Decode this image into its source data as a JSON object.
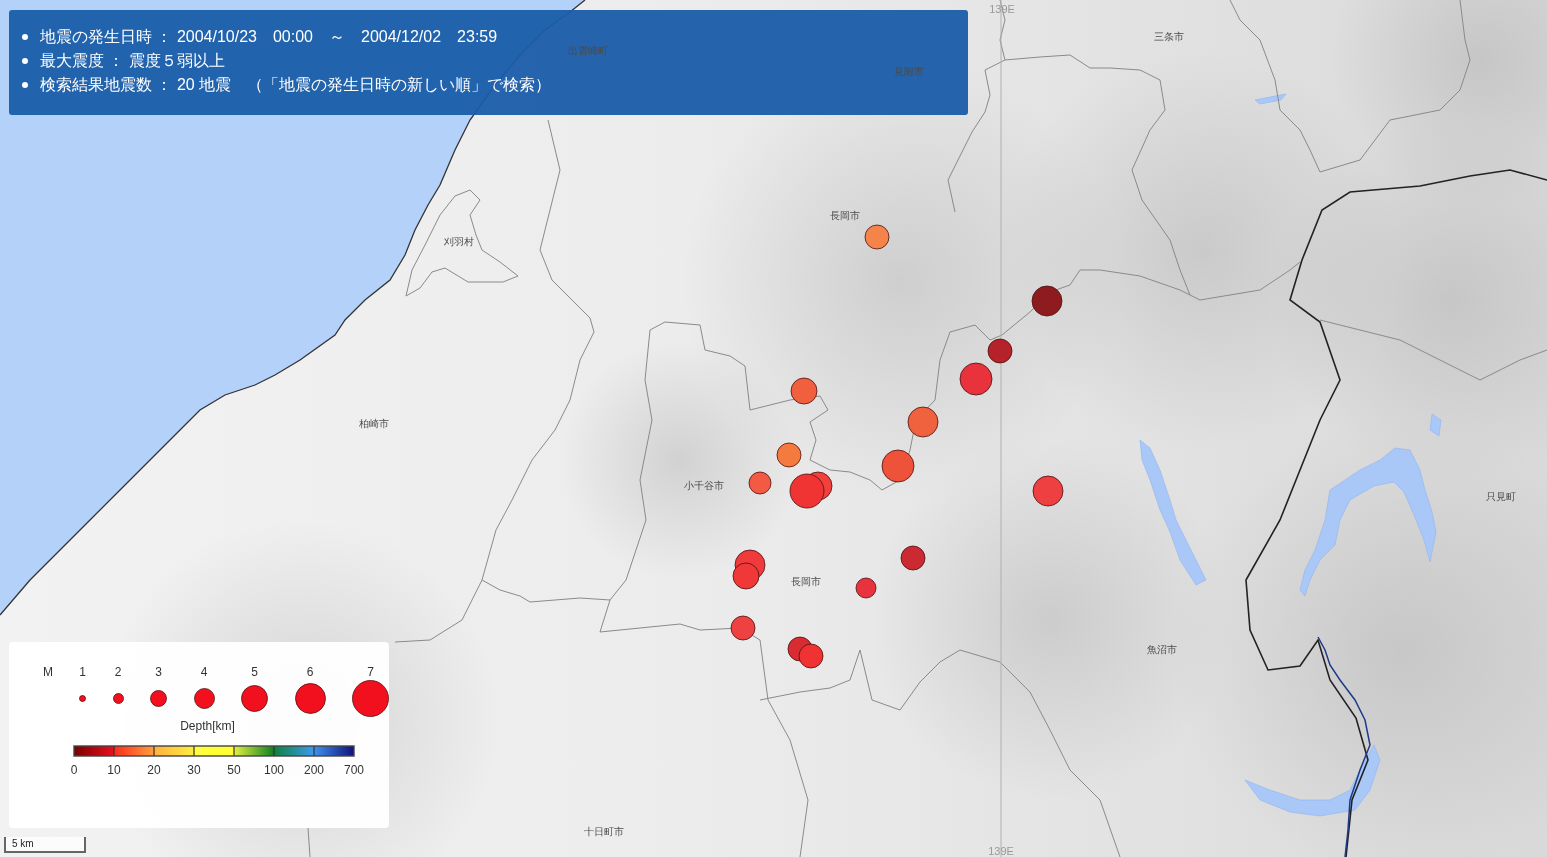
{
  "search_conditions": [
    "地震の発生日時 ： 2004/10/23　00:00　～　2004/12/02　23:59",
    "最大震度 ： 震度５弱以上",
    "検索結果地震数 ： 20 地震　（「地震の発生日時の新しい順」で検索）"
  ],
  "map": {
    "place_labels": [
      "三条市",
      "出雲崎町",
      "見附市",
      "長岡市",
      "刈羽村",
      "柏崎市",
      "小千谷市",
      "只見町",
      "長岡市",
      "魚沼市",
      "十日町市"
    ],
    "meridian_labels": [
      "139E",
      "139E"
    ],
    "earthquakes": [
      {
        "color": "#f5844a"
      },
      {
        "color": "#8e1c1e"
      },
      {
        "color": "#b5222a"
      },
      {
        "color": "#e8323c"
      },
      {
        "color": "#f0603e"
      },
      {
        "color": "#f0623e"
      },
      {
        "color": "#f57a3e"
      },
      {
        "color": "#ee5238"
      },
      {
        "color": "#f25a44"
      },
      {
        "color": "#f2403c"
      },
      {
        "color": "#f03434"
      },
      {
        "color": "#ee4040"
      },
      {
        "color": "#f03a3c"
      },
      {
        "color": "#f03838"
      },
      {
        "color": "#cc2a32"
      },
      {
        "color": "#e8323e"
      },
      {
        "color": "#ee4242"
      },
      {
        "color": "#d82c32"
      },
      {
        "color": "#f03232"
      }
    ],
    "scale": "5 km"
  },
  "legend": {
    "magnitude_title": "M",
    "magnitudes": [
      "1",
      "2",
      "3",
      "4",
      "5",
      "6",
      "7"
    ],
    "depth_title": "Depth[km]",
    "depth_ticks": [
      "0",
      "10",
      "20",
      "30",
      "50",
      "100",
      "200",
      "700"
    ]
  }
}
